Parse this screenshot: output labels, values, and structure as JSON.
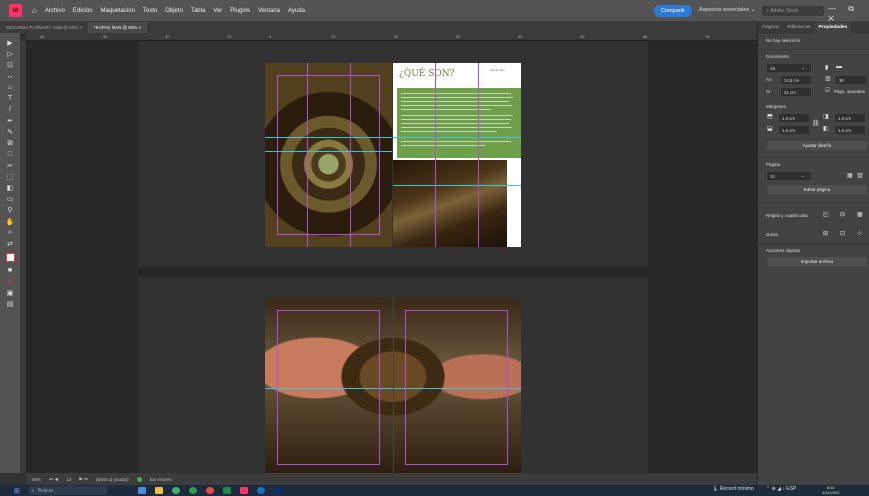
{
  "app": {
    "logo": "Id",
    "menu": [
      "Archivo",
      "Edición",
      "Maquetación",
      "Texto",
      "Objeto",
      "Tabla",
      "Ver",
      "Plugins",
      "Ventana",
      "Ayuda"
    ],
    "share_label": "Compartir",
    "workspace_label": "Aspectos esenciales",
    "search_placeholder": "Adobe Stock",
    "window_controls": "—  ⧉  ✕"
  },
  "tabs": [
    {
      "label": "SEGUNDA PLOMADA .indd @ 50%",
      "close": "×"
    },
    {
      "label": "*KAPAK ÑAN @ 50%",
      "close": "×"
    }
  ],
  "ruler_ticks": [
    "40",
    "30",
    "20",
    "10",
    "0",
    "10",
    "20",
    "30",
    "40",
    "50",
    "60",
    "70"
  ],
  "spread1": {
    "heading": "¿QUÉ SON?",
    "running_head": "Kapak Ñan"
  },
  "statusbar": {
    "zoom": "50%",
    "page": "13",
    "preflight_profile": "[Básico] (usado)",
    "preflight_status": "Sin errores"
  },
  "panel": {
    "tabs": [
      "Páginas",
      "Bibliotecas",
      "Propiedades"
    ],
    "no_selection": "No hay selección",
    "document_title": "Documento",
    "page_size": "A5",
    "width_label": "An",
    "width_value": "14,8 cm",
    "height_label": "Al",
    "height_value": "21 cm",
    "pages_value": "36",
    "facing_pages_label": "Págs. opuestas",
    "margins_title": "Márgenes",
    "margin_top": "1,5 cm",
    "margin_bottom": "1,5 cm",
    "margin_inside": "1,5 cm",
    "margin_outside": "1,5 cm",
    "adjust_layout": "Ajustar diseño",
    "page_title": "Página",
    "page_value": "14",
    "edit_page": "Editar página",
    "rulers_grids": "Reglas y cuadrículas",
    "guides": "Guías",
    "quick_actions": "Acciones rápidas",
    "import_file": "Importar archivo"
  },
  "taskbar": {
    "search_placeholder": "Buscar",
    "weather": "Récord mínimo",
    "tray_lang": "ESP",
    "clock_time": "8:46",
    "clock_date": "4/11/2024"
  },
  "colors": {
    "accent_blue": "#2d7bd6",
    "indesign_pink": "#ff3366",
    "heading_green": "#5c8c3a"
  }
}
